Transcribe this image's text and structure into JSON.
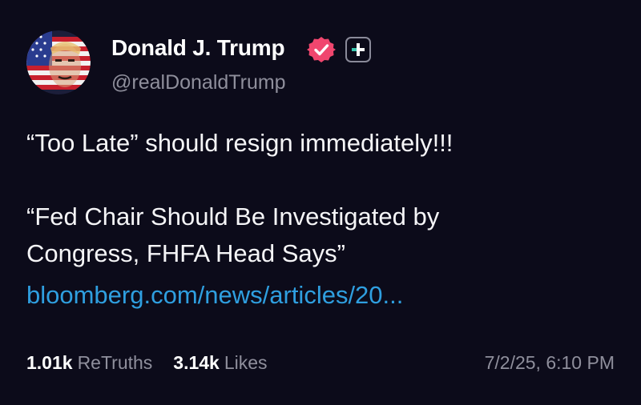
{
  "author": {
    "name": "Donald J. Trump",
    "handle": "@realDonaldTrump",
    "verified_color": "#f0466e",
    "plus_badge_icon": "plus-icon",
    "plus_badge_color": "#3ac8b0"
  },
  "post": {
    "line1": "“Too Late” should resign immediately!!!",
    "line2": "“Fed Chair Should Be Investigated by",
    "line3": "Congress, FHFA Head Says”",
    "link_text": "bloomberg.com/news/articles/20..."
  },
  "stats": {
    "retruths_count": "1.01k",
    "retruths_label": "ReTruths",
    "likes_count": "3.14k",
    "likes_label": "Likes"
  },
  "timestamp": "7/2/25, 6:10 PM",
  "colors": {
    "background": "#0c0b1a",
    "link": "#2f9fe0",
    "muted": "#8f8f9c"
  }
}
